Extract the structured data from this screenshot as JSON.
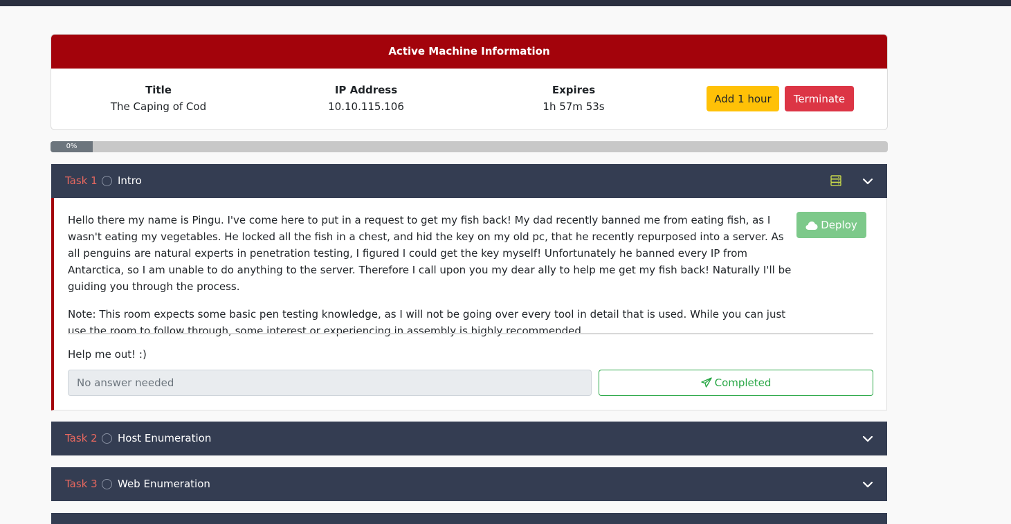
{
  "machine": {
    "header": "Active Machine Information",
    "title_label": "Title",
    "title_value": "The Caping of Cod",
    "ip_label": "IP Address",
    "ip_value": "10.10.115.106",
    "expires_label": "Expires",
    "expires_value": "1h 57m 53s",
    "add_hour_label": "Add 1 hour",
    "terminate_label": "Terminate"
  },
  "progress": {
    "label": "0%",
    "value_percent": 0
  },
  "tasks": [
    {
      "number": "Task 1",
      "name": "Intro",
      "expanded": true,
      "paragraphs": [
        "Hello there my name is Pingu. I've come here to put in a request to get my fish back! My dad recently banned me from eating fish, as I wasn't eating my vegetables. He locked all the fish in a chest, and hid the key on my old pc, that he recently repurposed into a server. As all penguins are natural experts in penetration testing, I figured I could get the key myself! Unfortunately he banned every IP from Antarctica, so I am unable to do anything to the server. Therefore I call upon you my dear ally to help me get my fish back! Naturally I'll be guiding you through the process.",
        "Note: This room expects some basic pen testing knowledge, as I will not be going over every tool in detail that is used. While you can just use the room to follow through, some interest or experiencing in assembly is highly recommended"
      ],
      "deploy_label": "Deploy",
      "question": "Help me out! :)",
      "answer_placeholder": "No answer needed",
      "completed_label": "Completed"
    },
    {
      "number": "Task 2",
      "name": "Host Enumeration",
      "expanded": false
    },
    {
      "number": "Task 3",
      "name": "Web Enumeration",
      "expanded": false
    }
  ],
  "colors": {
    "header_red": "#a3030b",
    "task_bar": "#343d52",
    "task_number": "#e8685f",
    "add_hour": "#ffc107",
    "terminate": "#dc3545",
    "completed": "#28a745"
  }
}
